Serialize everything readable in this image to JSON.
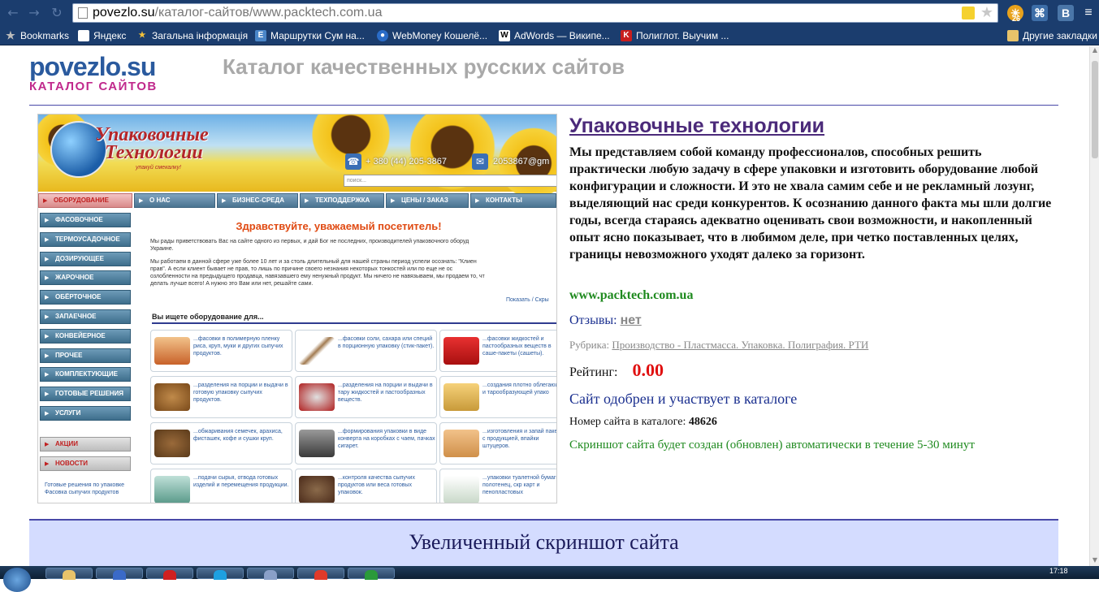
{
  "browser": {
    "address_host": "povezlo.su",
    "address_path": "/каталог-сайтов/www.packtech.com.ua",
    "extension_badge": "26",
    "bookmarks": [
      {
        "label": "Bookmarks",
        "icon": "star-icon"
      },
      {
        "label": "Яндекс",
        "icon": "page-icon"
      },
      {
        "label": "Загальна інформація",
        "icon": "figure-icon"
      },
      {
        "label": "Маршрутки Сум на...",
        "icon": "e-icon"
      },
      {
        "label": "WebMoney Кошелё...",
        "icon": "webmoney-icon"
      },
      {
        "label": "AdWords — Википе...",
        "icon": "wikipedia-icon"
      },
      {
        "label": "Полиглот. Выучим ...",
        "icon": "k-icon"
      }
    ],
    "other_bookmarks": "Другие закладки"
  },
  "site": {
    "logo_top": "povezlo.su",
    "logo_bottom": "КАТАЛОГ САЙТОВ",
    "headline": "Каталог качественных русских сайтов"
  },
  "screenshot": {
    "brand_line1": "Упаковочные",
    "brand_line2": "Технологии",
    "brand_tagline": "упакуй смекалку!",
    "phone": "+ 380 (44) 205-3867",
    "email": "2053867@gm",
    "search_placeholder": "поиск...",
    "top_nav": [
      "ОБОРУДОВАНИЕ",
      "О НАС",
      "БИЗНЕС-СРЕДА",
      "ТЕХПОДДЕРЖКА",
      "ЦЕНЫ / ЗАКАЗ",
      "КОНТАКТЫ"
    ],
    "side_nav": [
      "ФАСОВОЧНОЕ",
      "ТЕРМОУСАДОЧНОЕ",
      "ДОЗИРУЮЩЕЕ",
      "ЖАРОЧНОЕ",
      "ОБЁРТОЧНОЕ",
      "ЗАПАЕЧНОЕ",
      "КОНВЕЙЕРНОЕ",
      "ПРОЧЕЕ",
      "КОМПЛЕКТУЮЩИЕ",
      "ГОТОВЫЕ РЕШЕНИЯ",
      "УСЛУГИ"
    ],
    "side_extra": [
      "АКЦИИ",
      "НОВОСТИ"
    ],
    "side_news": "Готовые решения по упаковке  Фасовка сыпучих продуктов",
    "greeting": "Здравствуйте, уважаемый посетитель!",
    "intro_1": "Мы рады приветствовать Вас на сайте одного из первых, и дай Бог не последних, производителей упаковочного оборуд",
    "intro_2": "Украине.",
    "intro_3": "Мы работаем в данной сфере уже более 10 лет и за столь длительный для нашей страны период успели осознать: \"Клиен",
    "intro_4": "прав\". А если клиент бывает не прав, то лишь по причине своего незнания некоторых тонкостей или по еще не ос",
    "intro_5": "озлобленности на предыдущего продавца, навязавшего ему ненужный продукт. Мы ничего не навязываем, мы продаем то, чт",
    "intro_6": "делать лучше всего! А нужно это Вам или нет, решайте сами.",
    "show_link": "Показать / Скры",
    "looking_for": "Вы ищете оборудование для...",
    "grid": [
      "...фасовки в полимерную пленку риса, круп, муки и других сыпучих продуктов.",
      "...фасовки соли, сахара или специй в порционную упаковку (стик-пакет).",
      "...фасовки жидкостей и пастообразных веществ в саше-пакеты (сашеты).",
      "...разделения на порции и выдачи в готовую упаковку сыпучих продуктов.",
      "...разделения на порции и выдачи в тару жидкостей и пастообразных веществ.",
      "...создания плотно облегающей и тарообразующей упако",
      "...обжаривания семечек, арахиса, фисташек, кофе и сушки круп.",
      "...формирования упаковки в виде конверта на коробках с чаем, пачках сигарет.",
      "...изготовления и запай пакетов с продукцией, впайки штуцеров.",
      "...подачи сырья, отвода готовых изделий и перемещения продукции.",
      "...контроля качества сыпучих продуктов или веса готовых упаковок.",
      "...упаковки туалетной бумаги, полотенец, скр карт и пенопластовых"
    ]
  },
  "info": {
    "title": "Упаковочные технологии",
    "description": "Мы представляем собой команду профессионалов, способных решить практически любую задачу в сфере упаковки и изготовить оборудование любой конфигурации и сложности. И это не хвала самим себе и не рекламный лозунг, выделяющий нас среди конкурентов. К осознанию данного факта мы шли долгие годы, всегда стараясь адекватно оценивать свои возможности, и накопленный опыт ясно показывает, что в любимом деле, при четко поставленных целях, границы невозможного уходят далеко за горизонт.",
    "url": "www.packtech.com.ua",
    "reviews_label": "Отзывы:",
    "reviews_value": "нет",
    "rubric_label": "Рубрика:",
    "rubric_value": "Производство - Пластмасса. Упаковка. Полиграфия. РТИ",
    "rating_label": "Рейтинг:",
    "rating_value": "0.00",
    "approved": "Сайт одобрен и участвует в каталоге",
    "number_label": "Номер сайта в каталоге:",
    "number_value": "48626",
    "autoshot": "Скриншот сайта будет создан (обновлен) автоматически в течение 5-30 минут",
    "zoom_label": "Увеличенный скриншот сайта"
  },
  "taskbar": {
    "clock": "17:18"
  }
}
